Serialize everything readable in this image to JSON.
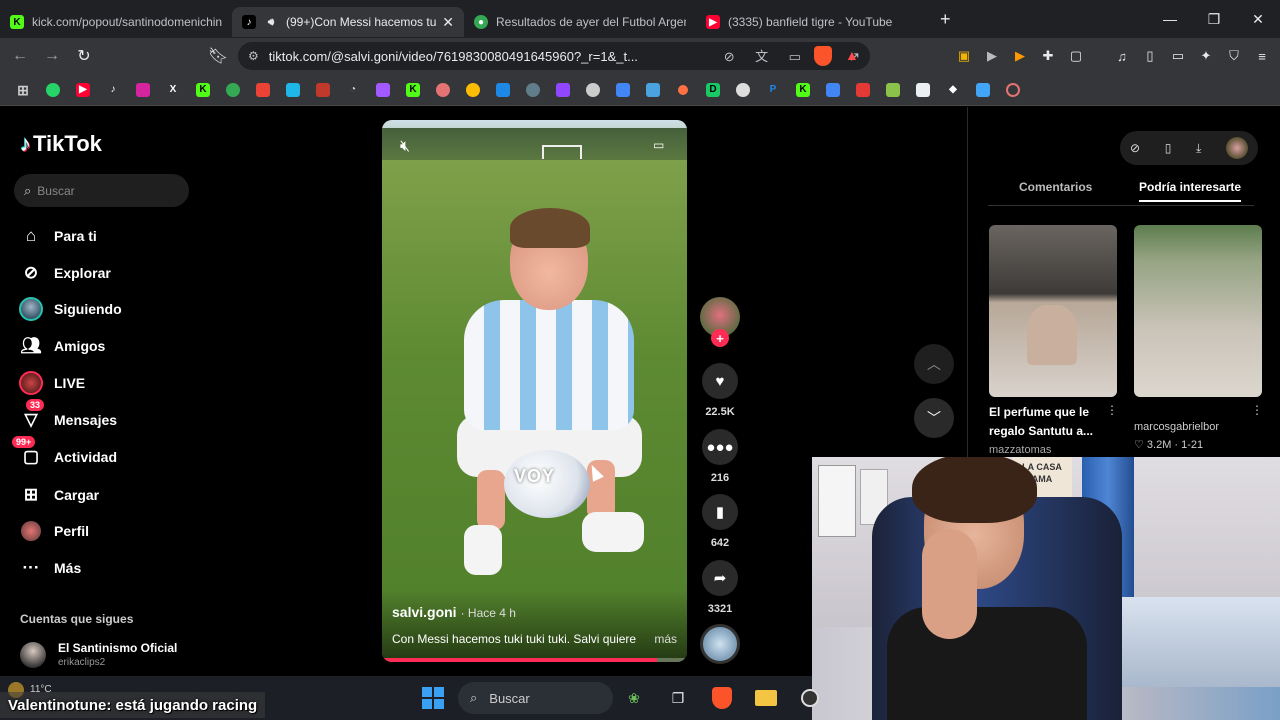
{
  "browser": {
    "tabs": [
      {
        "title": "kick.com/popout/santinodomenichin",
        "icon": "kick-icon",
        "color": "#53fc18",
        "active": false
      },
      {
        "title": "(99+)Con Messi hacemos tuki tuki",
        "icon": "tiktok-icon",
        "color": "#ffffff",
        "active": true
      },
      {
        "title": "Resultados de ayer del Futbol Argent",
        "icon": "soccer-icon",
        "color": "#34a853",
        "active": false
      },
      {
        "title": "(3335) banfield tigre - YouTube",
        "icon": "youtube-icon",
        "color": "#ff0033",
        "active": false
      }
    ],
    "new_tab": "+",
    "url": "tiktok.com/@salvi.goni/video/7619830080491645960?_r=1&_t...",
    "window_controls": [
      "minimize-icon",
      "maximize-icon",
      "close-icon"
    ],
    "bookmark_icons": [
      "apps-icon",
      "whatsapp-icon",
      "youtube-icon",
      "tiktok-icon",
      "instagram-icon",
      "x-icon",
      "kick-icon",
      "soccer-icon",
      "gmail-icon",
      "app-icon",
      "stats-icon",
      "clock-icon",
      "figma-icon",
      "kick-icon",
      "circle-icon",
      "chrome-icon",
      "trello-icon",
      "app-icon",
      "twitch-icon",
      "globe-icon",
      "docs-icon",
      "pen-icon",
      "dot-icon",
      "d-icon",
      "globe-icon",
      "paypal-icon",
      "kick-icon",
      "docs-icon",
      "download-icon",
      "download-icon",
      "file-icon",
      "diamond-icon",
      "download-icon",
      "circle-icon"
    ]
  },
  "tiktok": {
    "logo": "TikTok",
    "search_placeholder": "Buscar",
    "nav": [
      {
        "label": "Para ti",
        "icon": "home-icon"
      },
      {
        "label": "Explorar",
        "icon": "compass-icon"
      },
      {
        "label": "Siguiendo",
        "icon": "following-avatar-icon"
      },
      {
        "label": "Amigos",
        "icon": "friends-icon"
      },
      {
        "label": "LIVE",
        "icon": "live-icon"
      },
      {
        "label": "Mensajes",
        "icon": "messages-icon",
        "badge": "33"
      },
      {
        "label": "Actividad",
        "icon": "activity-icon",
        "badge": "99+"
      },
      {
        "label": "Cargar",
        "icon": "upload-icon"
      },
      {
        "label": "Perfil",
        "icon": "profile-icon"
      },
      {
        "label": "Más",
        "icon": "more-icon"
      }
    ],
    "following_title": "Cuentas que sigues",
    "following": [
      {
        "name": "El Santinismo Oficial",
        "handle": "erikaclips2"
      }
    ]
  },
  "video": {
    "overlay_text": "VOY",
    "author": "salvi.goni",
    "time": "· Hace 4 h",
    "description": "Con Messi hacemos tuki tuki tuki. Salvi quiere",
    "more": "más",
    "progress": 0.9
  },
  "actions": {
    "likes": "22.5K",
    "comments": "216",
    "saves": "642",
    "shares": "3321"
  },
  "right_panel": {
    "tabs": [
      "Comentarios",
      "Podría interesarte"
    ],
    "active_tab": "Podría interesarte",
    "cards": [
      {
        "title": "El perfume que le regalo Santutu a...",
        "user": "mazzatomas"
      },
      {
        "user": "marcosgabrielbor",
        "stats": "♡ 3.2M · 1-21"
      }
    ]
  },
  "webcam": {
    "sign_text": "LA CASA\nAMA"
  },
  "taskbar": {
    "weather": "11°C",
    "search_placeholder": "Buscar"
  },
  "chat": {
    "user": "Valentinotune",
    "message": ": está jugando racing"
  }
}
